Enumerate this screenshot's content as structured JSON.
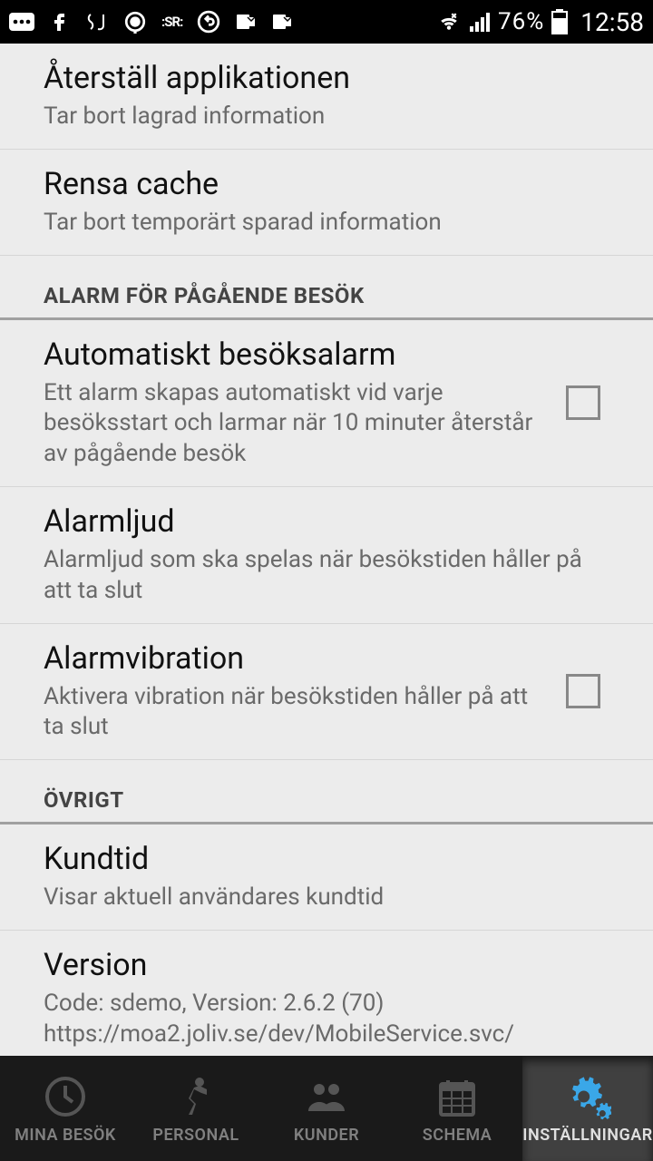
{
  "status": {
    "battery_pct": "76%",
    "time": "12:58"
  },
  "items": [
    {
      "title": "Återställ applikationen",
      "sub": "Tar bort lagrad information"
    },
    {
      "title": "Rensa cache",
      "sub": "Tar bort temporärt sparad information"
    }
  ],
  "section_alarm": "ALARM FÖR PÅGÅENDE BESÖK",
  "alarm_items": [
    {
      "title": "Automatiskt besöksalarm",
      "sub": "Ett alarm skapas automatiskt vid varje besöksstart och larmar när 10 minuter återstår av pågående besök",
      "checkbox": true
    },
    {
      "title": "Alarmljud",
      "sub": "Alarmljud som ska spelas när besökstiden håller på att ta slut",
      "checkbox": false
    },
    {
      "title": "Alarmvibration",
      "sub": "Aktivera vibration när besökstiden håller på att ta slut",
      "checkbox": true
    }
  ],
  "section_other": "ÖVRIGT",
  "other_items": [
    {
      "title": "Kundtid",
      "sub": "Visar aktuell användares kundtid"
    },
    {
      "title": "Version",
      "sub": "Code: sdemo, Version: 2.6.2 (70)\nhttps://moa2.joliv.se/dev/MobileService.svc/"
    }
  ],
  "nav": [
    {
      "label": "MINA BESÖK"
    },
    {
      "label": "PERSONAL"
    },
    {
      "label": "KUNDER"
    },
    {
      "label": "SCHEMA"
    },
    {
      "label": "INSTÄLLNINGAR"
    }
  ]
}
